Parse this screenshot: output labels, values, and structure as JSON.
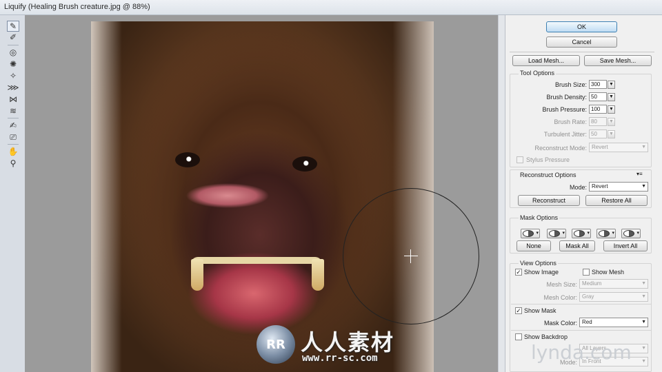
{
  "window": {
    "title": "Liquify (Healing Brush creature.jpg @ 88%)"
  },
  "tools": [
    {
      "name": "forward-warp-tool-icon",
      "glyph": "✎",
      "active": true
    },
    {
      "name": "reconstruct-tool-icon",
      "glyph": "✐"
    },
    {
      "name": "twirl-clockwise-tool-icon",
      "glyph": "◎"
    },
    {
      "name": "pucker-tool-icon",
      "glyph": "✺"
    },
    {
      "name": "bloat-tool-icon",
      "glyph": "✧"
    },
    {
      "name": "push-left-tool-icon",
      "glyph": "⋙"
    },
    {
      "name": "mirror-tool-icon",
      "glyph": "⋈"
    },
    {
      "name": "turbulence-tool-icon",
      "glyph": "≋"
    },
    {
      "name": "freeze-mask-tool-icon",
      "glyph": "✍"
    },
    {
      "name": "thaw-mask-tool-icon",
      "glyph": "⎚"
    },
    {
      "name": "hand-tool-icon",
      "glyph": "✋"
    },
    {
      "name": "zoom-tool-icon",
      "glyph": "⚲"
    }
  ],
  "buttons": {
    "ok": "OK",
    "cancel": "Cancel",
    "load_mesh": "Load Mesh...",
    "save_mesh": "Save Mesh..."
  },
  "tool_options": {
    "title": "Tool Options",
    "brush_size": {
      "label": "Brush Size:",
      "value": "300"
    },
    "brush_density": {
      "label": "Brush Density:",
      "value": "50"
    },
    "brush_pressure": {
      "label": "Brush Pressure:",
      "value": "100"
    },
    "brush_rate": {
      "label": "Brush Rate:",
      "value": "80"
    },
    "turbulent_jitter": {
      "label": "Turbulent Jitter:",
      "value": "50"
    },
    "reconstruct_mode": {
      "label": "Reconstruct Mode:",
      "value": "Revert"
    },
    "stylus_pressure": "Stylus Pressure"
  },
  "reconstruct_options": {
    "title": "Reconstruct Options",
    "mode_label": "Mode:",
    "mode_value": "Revert",
    "reconstruct": "Reconstruct",
    "restore_all": "Restore All"
  },
  "mask_options": {
    "title": "Mask Options",
    "none": "None",
    "mask_all": "Mask All",
    "invert_all": "Invert All"
  },
  "view_options": {
    "title": "View Options",
    "show_image": "Show Image",
    "show_image_checked": true,
    "show_mesh": "Show Mesh",
    "show_mesh_checked": false,
    "mesh_size_label": "Mesh Size:",
    "mesh_size_value": "Medium",
    "mesh_color_label": "Mesh Color:",
    "mesh_color_value": "Gray",
    "show_mask": "Show Mask",
    "show_mask_checked": true,
    "mask_color_label": "Mask Color:",
    "mask_color_value": "Red",
    "show_backdrop": "Show Backdrop",
    "show_backdrop_checked": false,
    "use_value": "All Layers",
    "mode_label": "Mode:",
    "mode_value": "In Front"
  },
  "watermark": {
    "chinese": "人人素材",
    "url": "www.rr-sc.com",
    "logo_text": "RR"
  },
  "branding": {
    "lynda": "lynda.com"
  },
  "colors": {
    "accent_button": "#3c7fb1",
    "canvas_gray": "#9b9b9b",
    "panel_bg": "#f0f0f0"
  }
}
